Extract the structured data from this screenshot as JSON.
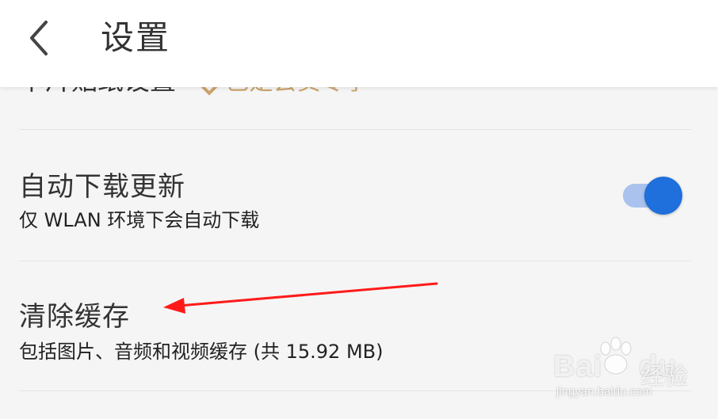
{
  "header": {
    "title": "设置",
    "back_icon": "chevron-left-icon"
  },
  "partial_row": {
    "title": "卡片贴纸设置",
    "badge": "已是会员专享"
  },
  "auto_update": {
    "title": "自动下载更新",
    "subtitle": "仅 WLAN 环境下会自动下载",
    "toggle_on": true,
    "toggle_color": "#1f6fdc"
  },
  "clear_cache": {
    "title": "清除缓存",
    "subtitle": "包括图片、音频和视频缓存 (共 15.92 MB)"
  },
  "annotation": {
    "arrow_color": "#ff1a1a"
  },
  "watermark": {
    "brand": "Bai",
    "brand2": "du",
    "cn": "经验",
    "url": "jingyan.baidu.com"
  }
}
